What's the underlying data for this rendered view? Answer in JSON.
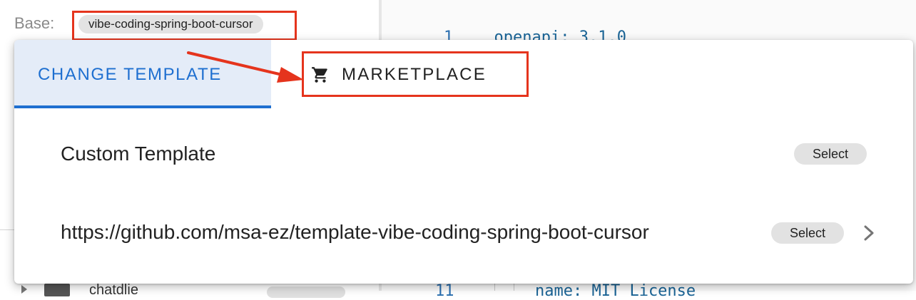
{
  "background": {
    "base_label": "Base:",
    "base_chip": "vibe-coding-spring-boot-cursor",
    "code_top_line_number": "1",
    "code_top_key": "openapi",
    "code_top_value": "3.1.0",
    "code_bottom_line_number": "11",
    "code_bottom_text": "name: MIT License",
    "tree_item_name": "chatdlie"
  },
  "dialog": {
    "tabs": {
      "change_template": "CHANGE TEMPLATE",
      "marketplace": "MARKETPLACE",
      "marketplace_icon": "shopping-cart-icon"
    },
    "rows": [
      {
        "label": "Custom Template",
        "select_label": "Select"
      },
      {
        "label": "https://github.com/msa-ez/template-vibe-coding-spring-boot-cursor",
        "select_label": "Select",
        "trailing_icon": "chevron-right-icon"
      }
    ]
  },
  "colors": {
    "accent": "#1e6fd0",
    "active_tab_bg": "#e4ecf8",
    "annotation": "#e5341d",
    "chip_bg": "#e2e2e2"
  }
}
